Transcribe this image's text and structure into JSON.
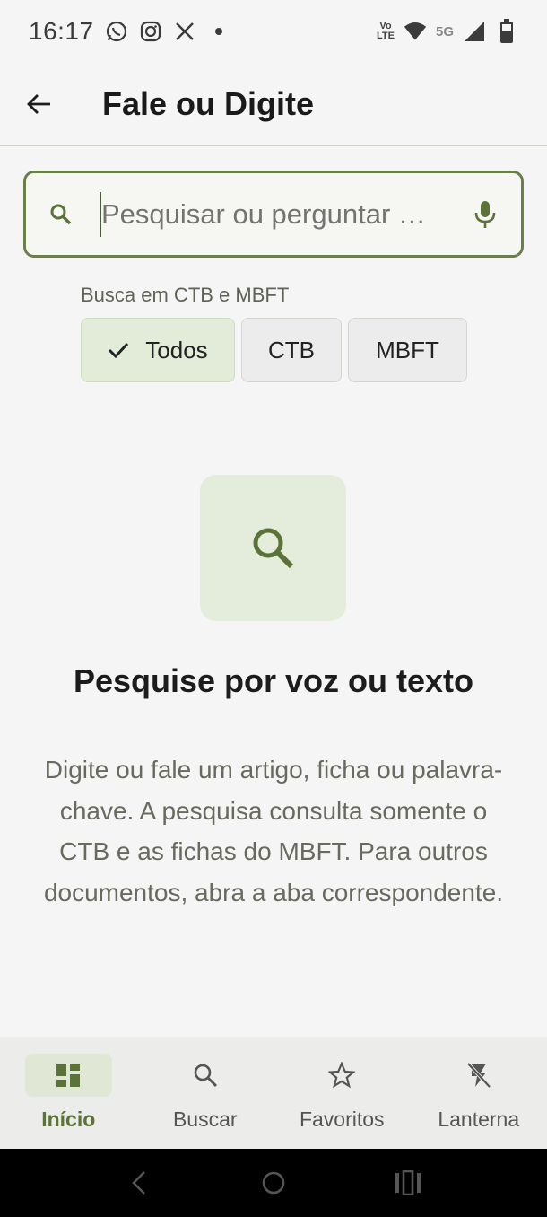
{
  "status_bar": {
    "time": "16:17",
    "left_icons": [
      "whatsapp-icon",
      "instagram-icon",
      "x-icon",
      "dot-icon"
    ],
    "volte_line1": "Vo",
    "volte_line2": "LTE",
    "network": "5G",
    "right_icons": [
      "wifi-icon",
      "signal-icon",
      "battery-icon"
    ]
  },
  "app_bar": {
    "title": "Fale ou Digite",
    "back_icon": "arrow-left-icon"
  },
  "search": {
    "placeholder": "Pesquisar ou perguntar …",
    "value": "",
    "leading_icon": "search-icon",
    "trailing_icon": "microphone-icon"
  },
  "filter": {
    "label": "Busca em CTB e MBFT",
    "chips": [
      {
        "label": "Todos",
        "selected": true
      },
      {
        "label": "CTB",
        "selected": false
      },
      {
        "label": "MBFT",
        "selected": false
      }
    ]
  },
  "empty_state": {
    "icon": "search-icon",
    "title": "Pesquise por voz ou texto",
    "description": "Digite ou fale um artigo, ficha ou palavra-chave. A pesquisa consulta somente o CTB e as fichas do MBFT. Para outros documentos, abra a aba correspondente."
  },
  "bottom_nav": {
    "items": [
      {
        "label": "Início",
        "icon": "dashboard-icon",
        "active": true
      },
      {
        "label": "Buscar",
        "icon": "search-icon",
        "active": false
      },
      {
        "label": "Favoritos",
        "icon": "star-icon",
        "active": false
      },
      {
        "label": "Lanterna",
        "icon": "flash-off-icon",
        "active": false
      }
    ]
  },
  "colors": {
    "accent": "#6b7f4a",
    "accent_text": "#5b7339",
    "chip_selected_bg": "#e3ebd9",
    "background": "#f5f5f5"
  }
}
